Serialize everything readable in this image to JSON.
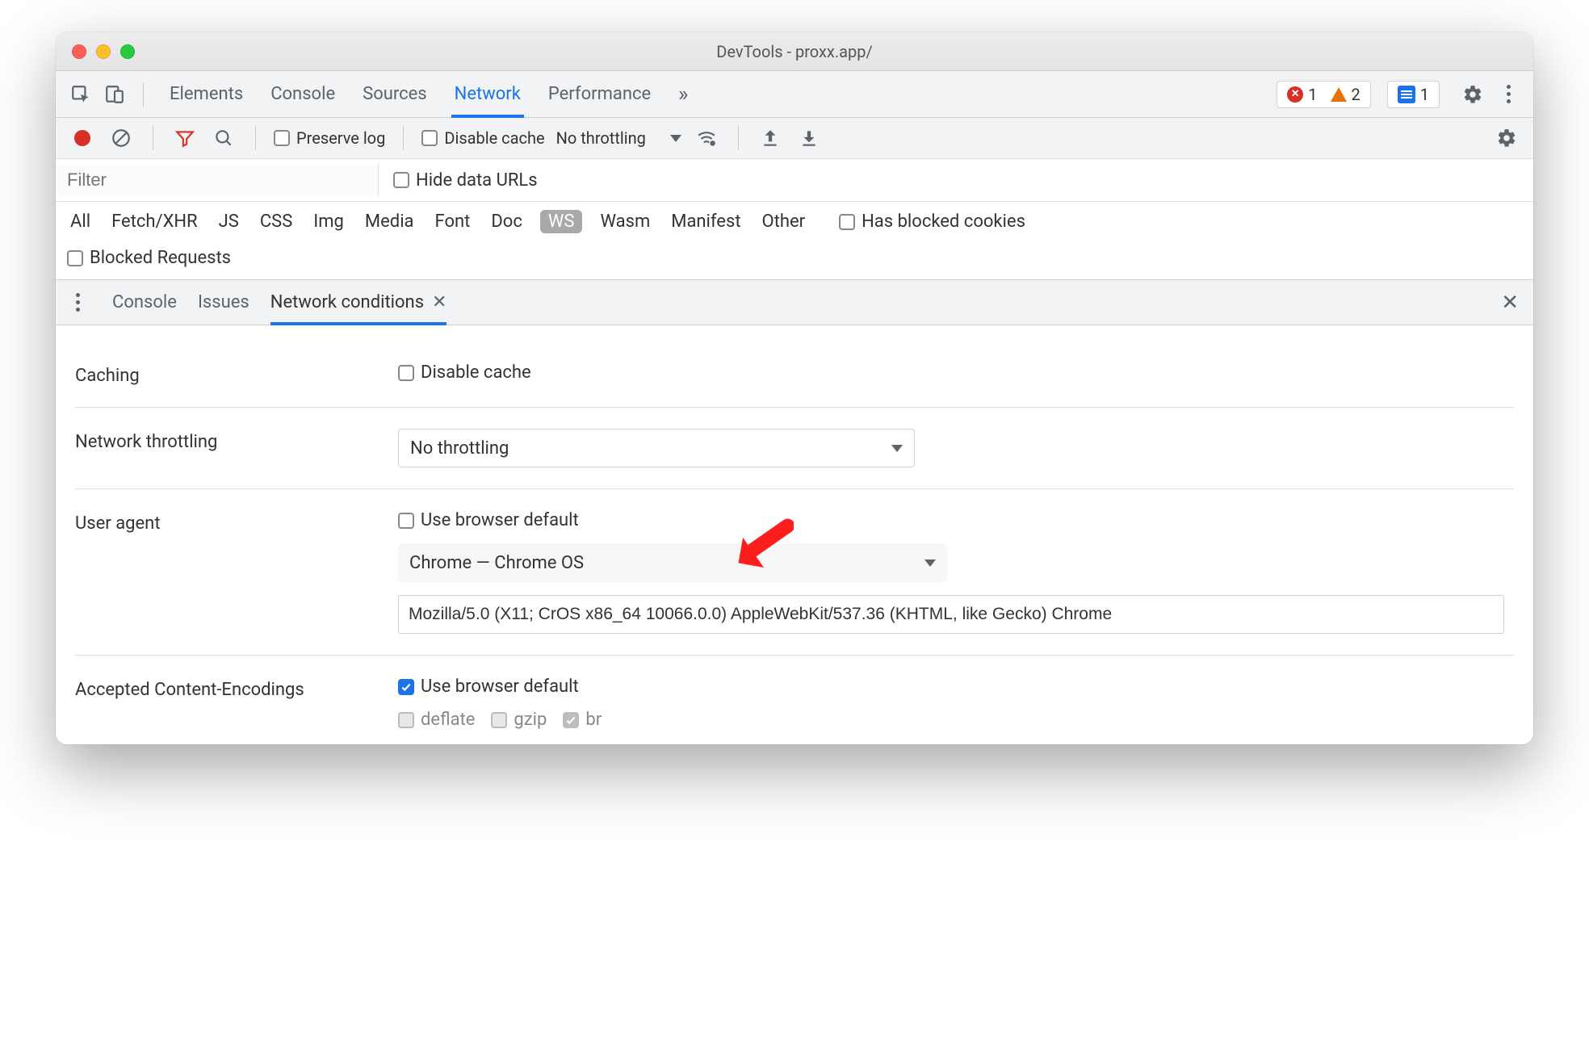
{
  "window": {
    "title": "DevTools - proxx.app/"
  },
  "tabs": {
    "items": [
      "Elements",
      "Console",
      "Sources",
      "Network",
      "Performance"
    ],
    "active": "Network",
    "overflow_glyph": "»"
  },
  "counters": {
    "errors": "1",
    "warnings": "2",
    "messages": "1"
  },
  "network_toolbar": {
    "preserve_log": "Preserve log",
    "disable_cache": "Disable cache",
    "throttling": "No throttling"
  },
  "filter": {
    "placeholder": "Filter",
    "hide_data_urls": "Hide data URLs",
    "types": [
      "All",
      "Fetch/XHR",
      "JS",
      "CSS",
      "Img",
      "Media",
      "Font",
      "Doc",
      "WS",
      "Wasm",
      "Manifest",
      "Other"
    ],
    "active_type": "WS",
    "has_blocked_cookies": "Has blocked cookies",
    "blocked_requests": "Blocked Requests"
  },
  "drawer": {
    "tabs": [
      "Console",
      "Issues",
      "Network conditions"
    ],
    "active": "Network conditions"
  },
  "conditions": {
    "caching": {
      "label": "Caching",
      "disable_cache": "Disable cache",
      "checked": false
    },
    "throttling": {
      "label": "Network throttling",
      "value": "No throttling"
    },
    "user_agent": {
      "label": "User agent",
      "use_default": "Use browser default",
      "use_default_checked": false,
      "preset": "Chrome — Chrome OS",
      "ua_string": "Mozilla/5.0 (X11; CrOS x86_64 10066.0.0) AppleWebKit/537.36 (KHTML, like Gecko) Chrome"
    },
    "encodings": {
      "label": "Accepted Content-Encodings",
      "use_default": "Use browser default",
      "use_default_checked": true,
      "options": [
        {
          "name": "deflate",
          "checked": false,
          "disabled": true
        },
        {
          "name": "gzip",
          "checked": false,
          "disabled": true
        },
        {
          "name": "br",
          "checked": true,
          "disabled": true
        }
      ]
    }
  },
  "annotation": {
    "arrow_target": "user-agent-preset"
  }
}
